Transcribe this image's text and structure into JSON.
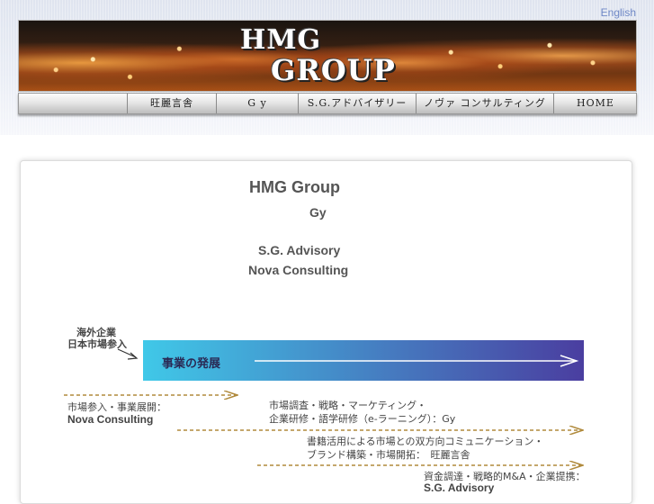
{
  "header": {
    "language_link": "English",
    "banner_line1": "HMG",
    "banner_line2": "GROUP"
  },
  "nav": {
    "items": [
      {
        "label": "旺麗言舎"
      },
      {
        "label": "G y"
      },
      {
        "label": "S.G.アドバイザリー"
      },
      {
        "label": "ノヴァ コンサルティング"
      },
      {
        "label": "HOME"
      }
    ]
  },
  "main": {
    "title": "HMG Group",
    "companies": [
      "Gy",
      "S.G. Advisory",
      "Nova Consulting"
    ]
  },
  "diagram": {
    "entry_label_line1": "海外企業",
    "entry_label_line2": "日本市場参入",
    "bar_label": "事業の発展",
    "colors": {
      "bar_start": "#40c8e8",
      "bar_end": "#4a3ea0",
      "dashed_arrow": "#b08a3c"
    },
    "stages": [
      {
        "desc_line1": "市場参入・事業展開：",
        "desc_line2": "Nova Consulting"
      },
      {
        "desc_line1": "市場調査・戦略・マーケティング・",
        "desc_line2": "企業研修・語学研修（e-ラーニング）：Gy"
      },
      {
        "desc_line1": "書籍活用による市場との双方向コミュニケーション・",
        "desc_line2": "ブランド構築・市場開拓：　旺麗言舎"
      },
      {
        "desc_line1": "資金調達・戦略的M&A・企業提携：",
        "desc_line2": "S.G. Advisory"
      }
    ]
  }
}
